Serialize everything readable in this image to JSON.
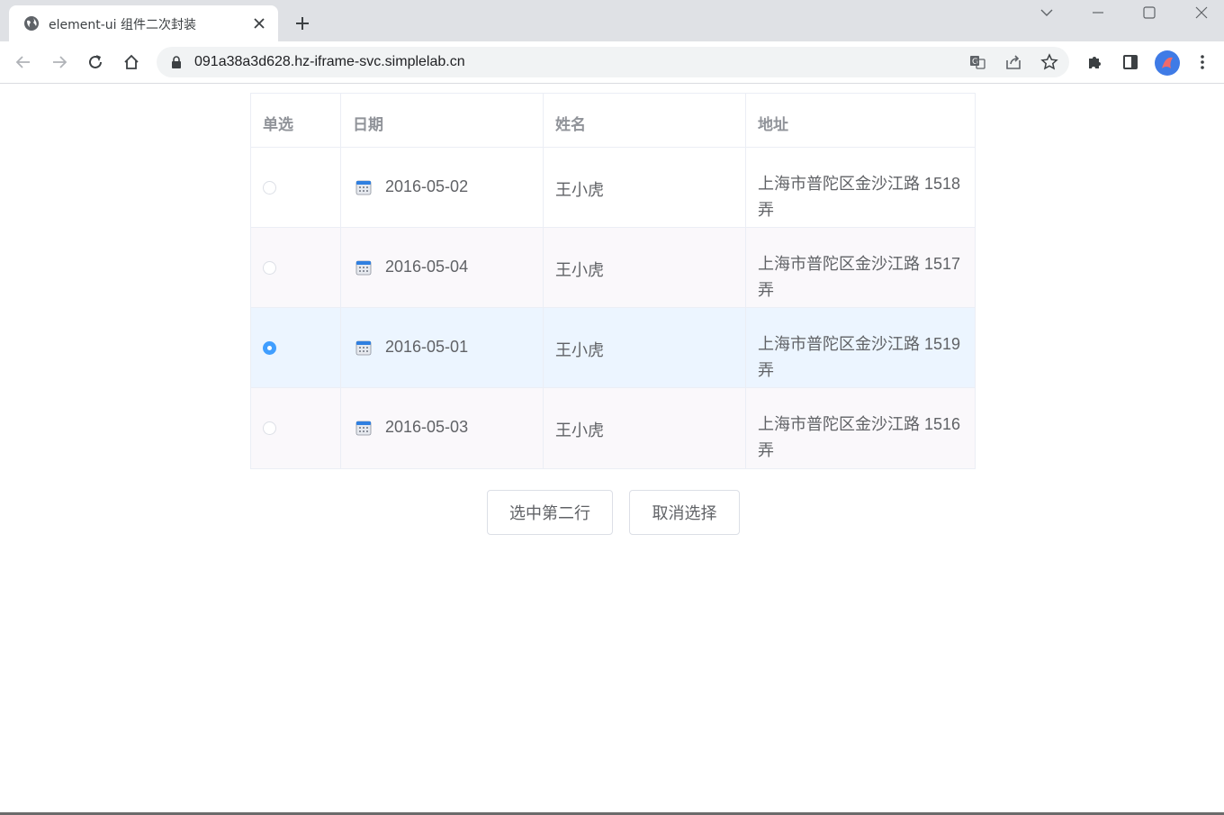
{
  "browser": {
    "tab_title": "element-ui 组件二次封装",
    "url": "091a38a3d628.hz-iframe-svc.simplelab.cn"
  },
  "table": {
    "headers": [
      "单选",
      "日期",
      "姓名",
      "地址"
    ],
    "rows": [
      {
        "date": "2016-05-02",
        "name": "王小虎",
        "address": "上海市普陀区金沙江路 1518 弄",
        "selected": false
      },
      {
        "date": "2016-05-04",
        "name": "王小虎",
        "address": "上海市普陀区金沙江路 1517 弄",
        "selected": false
      },
      {
        "date": "2016-05-01",
        "name": "王小虎",
        "address": "上海市普陀区金沙江路 1519 弄",
        "selected": true
      },
      {
        "date": "2016-05-03",
        "name": "王小虎",
        "address": "上海市普陀区金沙江路 1516 弄",
        "selected": false
      }
    ]
  },
  "buttons": {
    "select_second": "选中第二行",
    "cancel_select": "取消选择"
  },
  "colors": {
    "primary": "#409eff",
    "current_row": "#ecf5ff",
    "header_text": "#909399",
    "body_text": "#606266"
  }
}
